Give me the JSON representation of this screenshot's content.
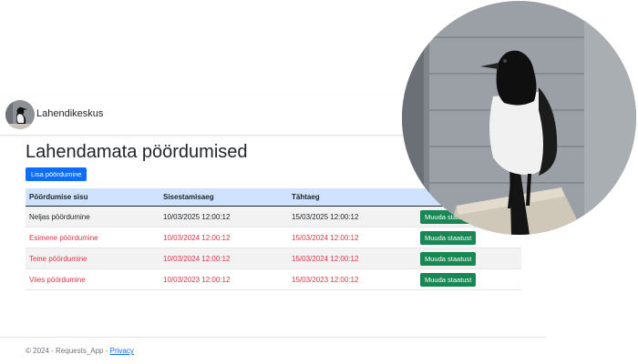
{
  "header": {
    "brand": "Lahendikeskus",
    "avatar_icon": "magpie-avatar-icon"
  },
  "main": {
    "title": "Lahendamata pöördumised",
    "add_button": "Lisa pöördumine",
    "table": {
      "columns": [
        "Pöördumise sisu",
        "Sisestamisaeg",
        "Tähtaeg",
        ""
      ],
      "rows": [
        {
          "content": "Neljas pöördumine",
          "created": "10/03/2025 12:00:12",
          "deadline": "15/03/2025 12:00:12",
          "action": "Muuda staatust",
          "overdue": false
        },
        {
          "content": "Esimene pöördumine",
          "created": "10/03/2024 12:00:12",
          "deadline": "15/03/2024 12:00:12",
          "action": "Muuda staatust",
          "overdue": true
        },
        {
          "content": "Teine pöördumine",
          "created": "10/03/2024 12:00:12",
          "deadline": "15/03/2024 12:00:12",
          "action": "Muuda staatust",
          "overdue": true
        },
        {
          "content": "Viies pöördumine",
          "created": "10/03/2023 12:00:12",
          "deadline": "15/03/2023 12:00:12",
          "action": "Muuda staatust",
          "overdue": true
        }
      ]
    }
  },
  "footer": {
    "text": "© 2024 - Requests_App - ",
    "privacy_link": "Privacy"
  },
  "overlay": {
    "photo_icon": "magpie-photo-icon"
  },
  "colors": {
    "primary": "#0d6efd",
    "success": "#198754",
    "danger": "#dc3545",
    "table_header": "#cfe2ff"
  }
}
